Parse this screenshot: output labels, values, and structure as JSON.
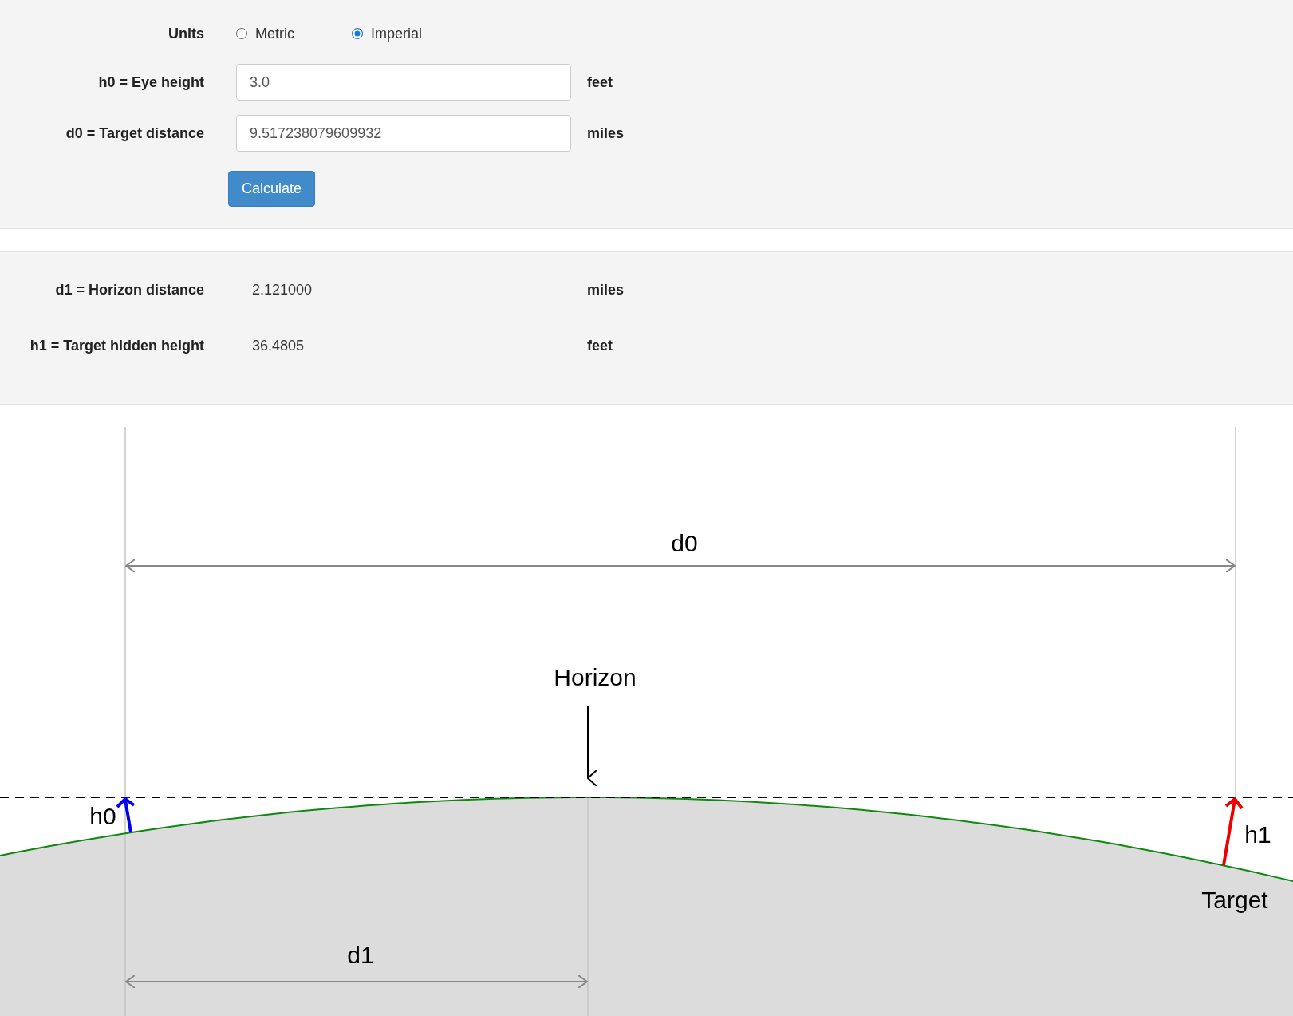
{
  "form": {
    "units": {
      "label": "Units",
      "options": [
        {
          "label": "Metric",
          "selected": false
        },
        {
          "label": "Imperial",
          "selected": true
        }
      ]
    },
    "fields": [
      {
        "label": "h0 = Eye height",
        "value": "3.0",
        "unit": "feet"
      },
      {
        "label": "d0 = Target distance",
        "value": "9.517238079609932",
        "unit": "miles"
      }
    ],
    "button": "Calculate"
  },
  "results": [
    {
      "label": "d1 = Horizon distance",
      "value": "2.121000",
      "unit": "miles"
    },
    {
      "label": "h1 = Target hidden height",
      "value": "36.4805",
      "unit": "feet"
    }
  ],
  "diagram": {
    "d0_label": "d0",
    "horizon_label": "Horizon",
    "h0_label": "h0",
    "h1_label": "h1",
    "target_label": "Target",
    "d1_label": "d1"
  }
}
